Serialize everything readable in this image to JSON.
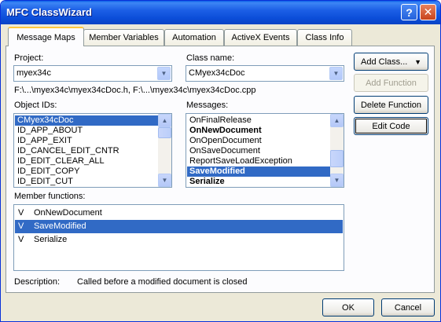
{
  "window": {
    "title": "MFC ClassWizard",
    "help_glyph": "?",
    "close_glyph": "✕"
  },
  "tabs": [
    {
      "label": "Message Maps",
      "active": true
    },
    {
      "label": "Member Variables"
    },
    {
      "label": "Automation"
    },
    {
      "label": "ActiveX Events"
    },
    {
      "label": "Class Info"
    }
  ],
  "project": {
    "label": "Project:",
    "value": "myex34c"
  },
  "class_name": {
    "label": "Class name:",
    "value": "CMyex34cDoc"
  },
  "file_path": "F:\\...\\myex34c\\myex34cDoc.h, F:\\...\\myex34c\\myex34cDoc.cpp",
  "object_ids": {
    "label": "Object IDs:",
    "items": [
      "CMyex34cDoc",
      "ID_APP_ABOUT",
      "ID_APP_EXIT",
      "ID_CANCEL_EDIT_CNTR",
      "ID_EDIT_CLEAR_ALL",
      "ID_EDIT_COPY",
      "ID_EDIT_CUT"
    ],
    "selected": "CMyex34cDoc"
  },
  "messages": {
    "label": "Messages:",
    "items": [
      "OnFinalRelease",
      "OnNewDocument",
      "OnOpenDocument",
      "OnSaveDocument",
      "ReportSaveLoadException",
      "SaveModified",
      "Serialize"
    ],
    "bold": [
      "OnNewDocument",
      "SaveModified",
      "Serialize"
    ],
    "selected": "SaveModified"
  },
  "buttons": {
    "add_class": "Add Class...",
    "add_function": "Add Function",
    "delete_function": "Delete Function",
    "edit_code": "Edit Code"
  },
  "member_functions": {
    "label": "Member functions:",
    "rows": [
      {
        "flag": "V",
        "name": "OnNewDocument"
      },
      {
        "flag": "V",
        "name": "SaveModified"
      },
      {
        "flag": "V",
        "name": "Serialize"
      }
    ],
    "selected": "SaveModified"
  },
  "description": {
    "label": "Description:",
    "text": "Called before a modified document is closed"
  },
  "dialog_buttons": {
    "ok": "OK",
    "cancel": "Cancel"
  }
}
